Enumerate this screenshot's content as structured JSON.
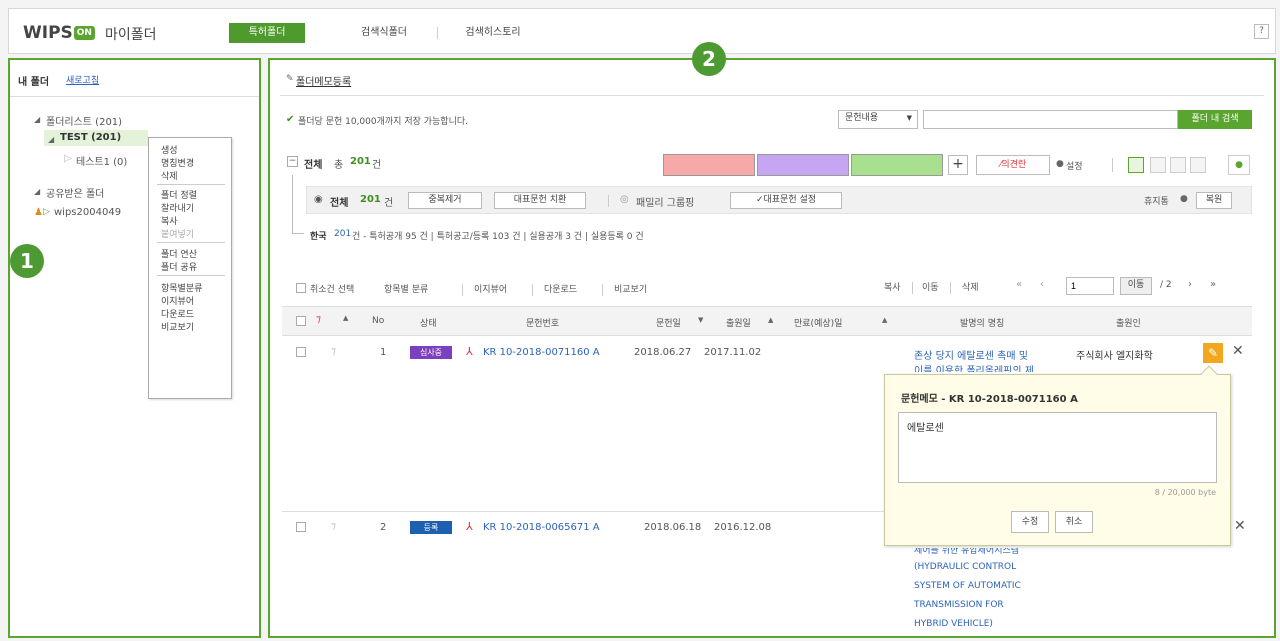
{
  "header": {
    "logo_text": "WIPS",
    "logo_badge": "ON",
    "app_title": "마이폴더",
    "tabs": [
      "특허폴더",
      "검색식폴더",
      "검색히스토리"
    ],
    "help": "?"
  },
  "left": {
    "title": "내 폴더",
    "refresh": "새로고침",
    "tree": {
      "folder_list": "폴더리스트 (201)",
      "test": "TEST (201)",
      "test1": "테스트1 (0)",
      "shared": "공유받은 폴더",
      "shared_user": "wips2004049"
    },
    "context_menu": [
      "생성",
      "명칭변경",
      "삭제",
      "폴더 정렬",
      "잘라내기",
      "복사",
      "붙여넣기",
      "폴더 연산",
      "폴더 공유",
      "항목별분류",
      "이지뷰어",
      "다운로드",
      "비교보기"
    ]
  },
  "right": {
    "memo_register": "폴더메모등록",
    "limit_notice": "폴더당 문헌 10,000개까지 저장 가능합니다.",
    "search_select": "문헌내용",
    "search_placeholder": "",
    "search_button": "폴더 내 검색",
    "total_label": "전체",
    "total_prefix": "총",
    "total_count": "201",
    "total_unit": "건",
    "opinion_button": "의견란",
    "settings_label": "설정",
    "filter": {
      "all_label": "전체",
      "all_count": "201",
      "all_unit": "건",
      "dedupe": "중복제거",
      "rep_replace": "대표문헌 치환",
      "family": "패밀리 그룹핑",
      "rep_setting": "✓대표문헌 설정",
      "trash": "휴지통",
      "restore": "복원"
    },
    "country_label": "한국",
    "country_count": "201",
    "stats": "건 - 특허공개 95 건  |  특허공고/등록 103 건  |  실용공개 3 건  |  실용등록 0 건",
    "toolbar": {
      "cancel_select": "취소건 선택",
      "classify": "항목별 분류",
      "easyviewer": "이지뷰어",
      "download": "다운로드",
      "compare": "비교보기",
      "copy": "복사",
      "move": "이동",
      "delete": "삭제",
      "page": "1",
      "go": "이동",
      "total_pages": "/ 2"
    },
    "columns": {
      "no": "No",
      "status": "상태",
      "doc_no": "문헌번호",
      "doc_date": "문헌일",
      "app_date": "출원일",
      "expiry": "만료(예상)일",
      "title": "발명의 명칭",
      "applicant": "출원인"
    },
    "rows": [
      {
        "no": "1",
        "status": "심사중",
        "status_color": "#7b3fbf",
        "doc_no": "KR 10-2018-0071160 A",
        "doc_date": "2018.06.27",
        "app_date": "2017.11.02",
        "title_lines": [
          "존상 당지 에탈로센 촉매 및",
          "이를 이용한 폴리올레핀의 제"
        ],
        "applicant": "주식회사 엘지화학"
      },
      {
        "no": "2",
        "status": "등록",
        "status_color": "#1e5fb0",
        "doc_no": "KR 10-2018-0065671 A",
        "doc_date": "2018.06.18",
        "app_date": "2016.12.08",
        "title_lines": [
          "제어를 위한 유압제어시스템",
          "(HYDRAULIC CONTROL",
          "SYSTEM OF AUTOMATIC",
          "TRANSMISSION FOR",
          "HYBRID VEHICLE)"
        ],
        "applicant": ""
      }
    ],
    "memo_popup": {
      "title": "문헌메모 - KR 10-2018-0071160 A",
      "text": "에탈로센",
      "counter": "8 / 20,000 byte",
      "edit": "수정",
      "cancel": "취소"
    },
    "colors": {
      "box1": "#f7a8a8",
      "box2": "#c6a6f2",
      "box3": "#a8e08f",
      "accent": "#4f9a2c"
    }
  },
  "markers": [
    "1",
    "2"
  ]
}
